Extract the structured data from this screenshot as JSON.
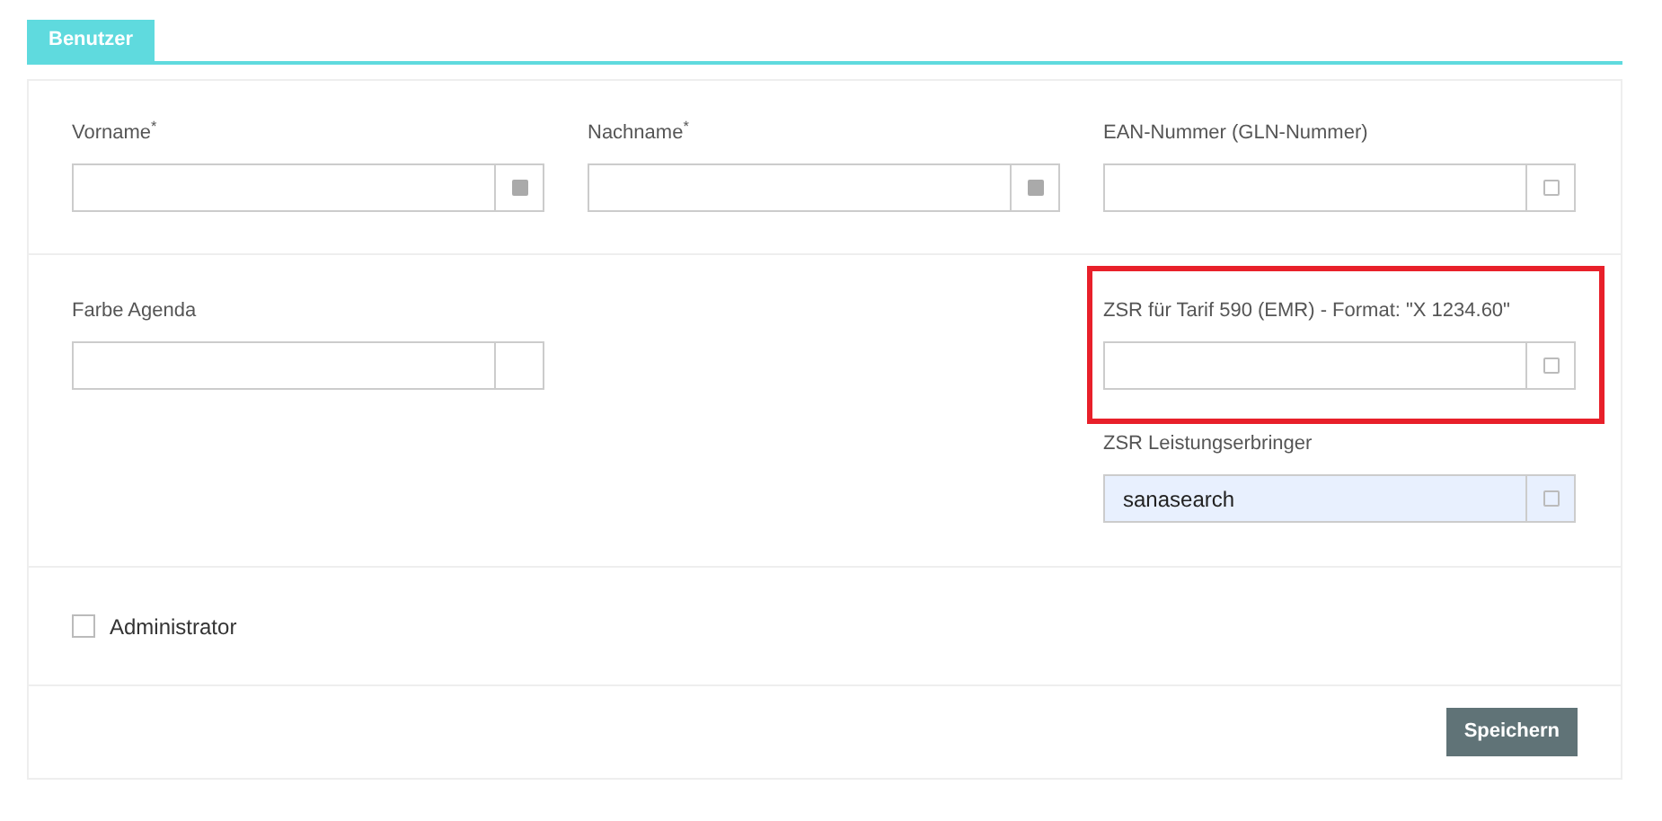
{
  "tabs": [
    {
      "label": "Benutzer",
      "selected": true
    }
  ],
  "sections": [
    {
      "fields": [
        {
          "label": "Vorname$^{*}$",
          "kind": "text",
          "required": true,
          "highlighted": false
        },
        {
          "label": "Nachname$^{*}$",
          "kind": "text",
          "required": true,
          "highlighted": false
        },
        {
          "label": "EAN-Nummer (GLN-Nummer)",
          "kind": "text",
          "required": false,
          "highlighted": false
        }
      ]
    },
    {
      "fields": [
        {
          "label": "Farbe Agenda",
          "kind": "color"
        },
        {
          "kind": "spacer"
        },
        {
          "kind": "stack",
          "children": [
            {
              "label": "ZSR für Tarif 590 (EMR) - Format: \"X 1234.60\"",
              "kind": "text",
              "required": false,
              "highlighted": true
            },
            {
              "label": "ZSR Leistungserbringer",
              "kind": "text",
              "required": false,
              "highlighted": false,
              "value": "sanasearch",
              "autofilled": true
            }
          ]
        }
      ]
    }
  ],
  "checkbox": {
    "label": "Administrator",
    "checked": false
  },
  "save_button": "Speichern"
}
